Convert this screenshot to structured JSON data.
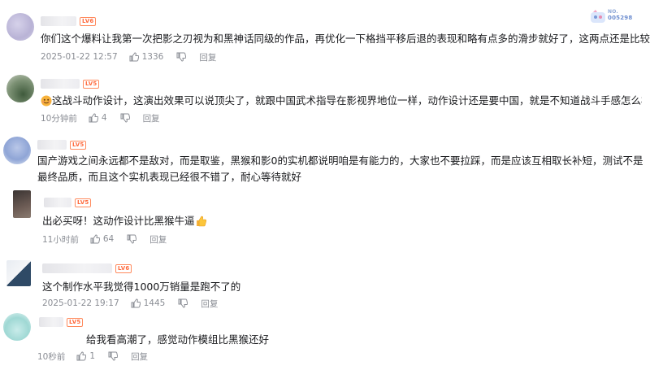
{
  "icons": {
    "like": "thumb-up-icon",
    "dislike": "thumb-down-icon"
  },
  "badge": {
    "line1": "NO.",
    "line2": "005298"
  },
  "comments": [
    {
      "level": "LV6",
      "text": "你们这个爆料让我第一次把影之刃视为和黑神话同级的作品，再优化一下格挡平移后退的表现和略有点多的滑步就好了，这两点还是比较突兀，出必买",
      "time": "2025-01-22 12:57",
      "likes": "1336",
      "reply": "回复"
    },
    {
      "level": "LV5",
      "text": "这战斗动作设计，这演出效果可以说顶尖了，就跟中国武术指导在影视界地位一样，动作设计还是要中国，就是不知道战斗手感怎么样",
      "time": "10分钟前",
      "likes": "4",
      "reply": "回复"
    },
    {
      "level": "LV5",
      "text": "国产游戏之间永远都不是敌对，而是取鉴，黑猴和影0的实机都说明咱是有能力的，大家也不要拉踩，而是应该互相取长补短，测试不是最终品质，而且这个实机表现已经很不错了，耐心等待就好",
      "time": "",
      "likes": "",
      "reply": ""
    },
    {
      "level": "LV5",
      "text": "出必买呀！这动作设计比黑猴牛逼",
      "time": "11小时前",
      "likes": "64",
      "reply": "回复"
    },
    {
      "level": "LV6",
      "text": "这个制作水平我觉得1000万销量是跑不了的",
      "time": "2025-01-22 19:17",
      "likes": "1445",
      "reply": "回复"
    },
    {
      "level": "LV5",
      "text": "给我看高潮了，感觉动作模组比黑猴还好",
      "time": "10秒前",
      "likes": "1",
      "reply": "回复"
    }
  ]
}
